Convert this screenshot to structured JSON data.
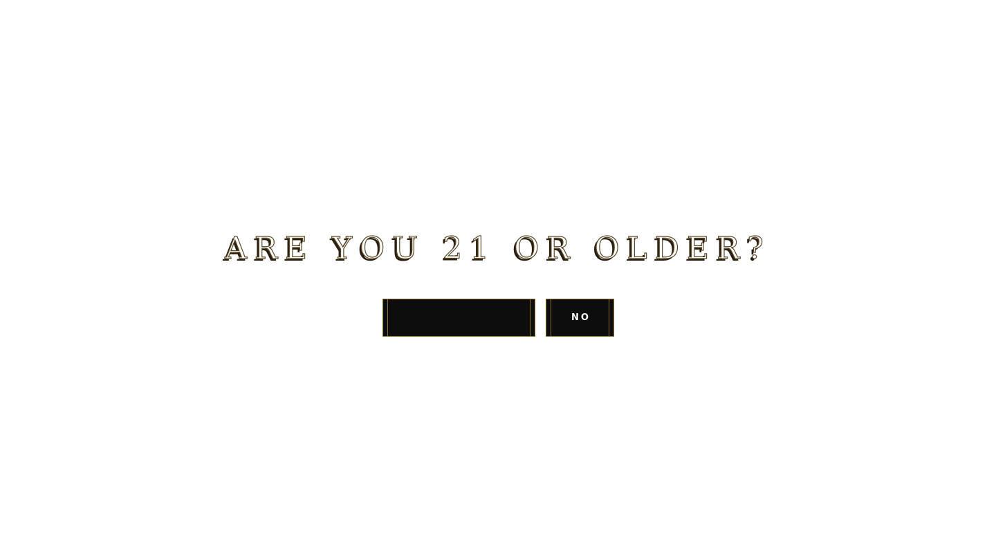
{
  "age_gate": {
    "question": "ARE YOU 21 OR OLDER?",
    "yes_label": "",
    "no_label": "NO"
  },
  "colors": {
    "background": "#ffffff",
    "button_fill": "#0d0d0d",
    "button_border": "#8a6f2e",
    "title_outline": "#5a4828"
  }
}
